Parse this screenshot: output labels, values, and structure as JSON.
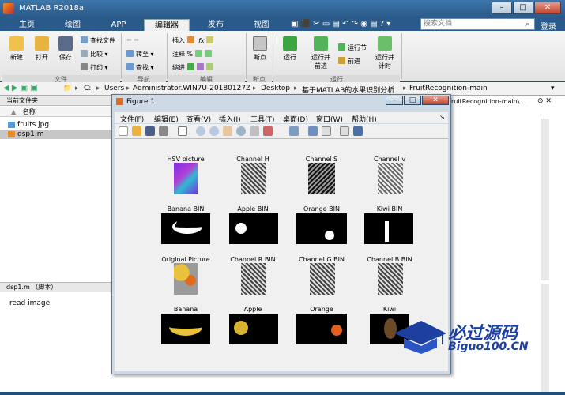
{
  "app": {
    "title": "MATLAB R2018a",
    "search_placeholder": "搜索文档",
    "login": "登录"
  },
  "tabs": [
    "主页",
    "绘图",
    "APP",
    "编辑器",
    "发布",
    "视图"
  ],
  "ribbon": {
    "new": "新建",
    "open": "打开",
    "save": "保存",
    "find_files": "查找文件",
    "compare": "比较",
    "print": "打印",
    "goto": "转至",
    "find": "查找",
    "insert": "插入",
    "comment": "注释",
    "indent": "缩进",
    "breakpoints": "断点",
    "run": "运行",
    "run_advance": "运行并\n前进",
    "run_section": "运行节",
    "advance": "前进",
    "run_time": "运行并\n计时",
    "groups": {
      "file": "文件",
      "nav": "导航",
      "edit": "编辑",
      "bp": "断点",
      "run": "运行"
    }
  },
  "address": {
    "parts": [
      "C:",
      "Users",
      "Administrator.WIN7U-20180127Z",
      "Desktop",
      "基于MATLAB的水果识别分析",
      "FruitRecognition-main"
    ],
    "right_path": "FruitRecognition-main\\..."
  },
  "left_panel": {
    "title": "当前文件夹",
    "col_name": "名称",
    "col_sort": "▲",
    "files": [
      {
        "name": "fruits.jpg"
      },
      {
        "name": "dsp1.m"
      }
    ]
  },
  "details": {
    "title": "dsp1.m （脚本）",
    "body": "read image"
  },
  "figure": {
    "title": "Figure 1",
    "menu": [
      "文件(F)",
      "编辑(E)",
      "查看(V)",
      "插入(I)",
      "工具(T)",
      "桌面(D)",
      "窗口(W)",
      "帮助(H)"
    ],
    "labels": [
      "HSV picture",
      "Channel H",
      "Channel S",
      "Channel v",
      "Banana BIN",
      "Apple BIN",
      "Orange BIN",
      "Kiwi BIN",
      "Original Picture",
      "Channel R BIN",
      "Channel G BIN",
      "Channel B BIN",
      "Banana",
      "Apple",
      "Orange",
      "Kiwi"
    ]
  },
  "watermark": {
    "line1": "必过源码",
    "line2": "Biguo100.CN"
  }
}
